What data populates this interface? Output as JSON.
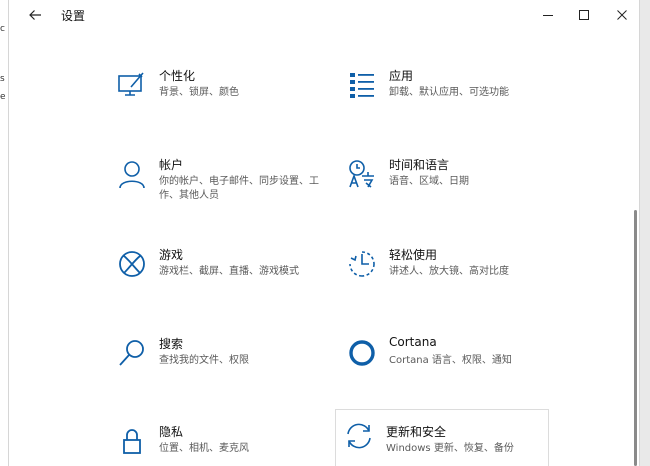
{
  "window": {
    "title": "设置"
  },
  "behind": {
    "frags": [
      "c",
      "s",
      "e"
    ]
  },
  "tiles": [
    {
      "key": "personalization",
      "icon": "personalization-icon",
      "title": "个性化",
      "desc": "背景、锁屏、颜色"
    },
    {
      "key": "apps",
      "icon": "apps-list-icon",
      "title": "应用",
      "desc": "卸载、默认应用、可选功能"
    },
    {
      "key": "accounts",
      "icon": "account-person-icon",
      "title": "帐户",
      "desc": "你的帐户、电子邮件、同步设置、工作、其他人员"
    },
    {
      "key": "time-language",
      "icon": "time-language-icon",
      "title": "时间和语言",
      "desc": "语音、区域、日期"
    },
    {
      "key": "gaming",
      "icon": "xbox-icon",
      "title": "游戏",
      "desc": "游戏栏、截屏、直播、游戏模式"
    },
    {
      "key": "ease-of-access",
      "icon": "ease-of-access-icon",
      "title": "轻松使用",
      "desc": "讲述人、放大镜、高对比度"
    },
    {
      "key": "search",
      "icon": "search-icon",
      "title": "搜索",
      "desc": "查找我的文件、权限"
    },
    {
      "key": "cortana",
      "icon": "cortana-ring-icon",
      "title": "Cortana",
      "desc": "Cortana 语言、权限、通知"
    },
    {
      "key": "privacy",
      "icon": "lock-icon",
      "title": "隐私",
      "desc": "位置、相机、麦克风"
    },
    {
      "key": "update-security",
      "icon": "update-sync-icon",
      "title": "更新和安全",
      "desc": "Windows 更新、恢复、备份"
    }
  ],
  "colors": {
    "accent": "#0f5fa8",
    "title_text": "#111111",
    "desc_text": "#5a5a5a"
  }
}
